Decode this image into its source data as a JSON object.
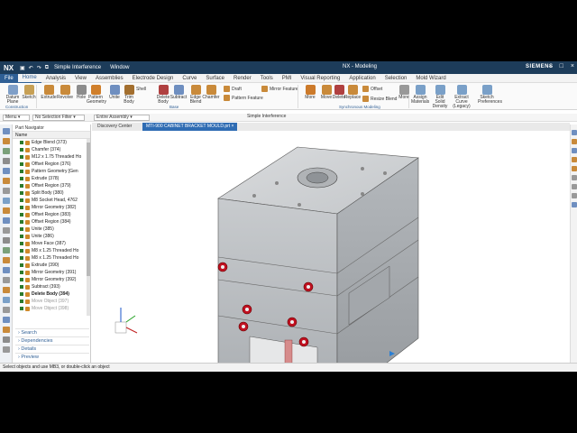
{
  "titlebar": {
    "logo": "NX",
    "command1": "Simple Interference",
    "command2": "Window",
    "center_title": "NX - Modeling",
    "brand": "SIEMENS"
  },
  "tabs": [
    "File",
    "Home",
    "Analysis",
    "View",
    "Assemblies",
    "Electrode Design",
    "Curve",
    "Surface",
    "Render",
    "Tools",
    "PMI",
    "Visual Reporting",
    "Application",
    "Selection",
    "Mold Wizard"
  ],
  "active_tab": "Home",
  "ribbon": {
    "buttons": [
      {
        "label": "Datum Plane",
        "color": "#7f9fc8"
      },
      {
        "label": "Sketch",
        "color": "#c7a055"
      },
      {
        "label": "Extrude",
        "color": "#c98a3a"
      },
      {
        "label": "Revolve",
        "color": "#c98a3a"
      },
      {
        "label": "Hole",
        "color": "#8c8c8c"
      },
      {
        "label": "Pattern Geometry",
        "color": "#d07f2b"
      },
      {
        "label": "Unite",
        "color": "#6f8fc0"
      },
      {
        "label": "Trim Body",
        "color": "#a36f2f"
      },
      {
        "label": "Delete Body",
        "color": "#b04040"
      },
      {
        "label": "Subtract",
        "color": "#6f8fc0"
      },
      {
        "label": "Edge Blend",
        "color": "#c98a3a"
      },
      {
        "label": "Chamfer",
        "color": "#c98a3a"
      },
      {
        "label": "More",
        "color": "#cc7a2a"
      },
      {
        "label": "Move",
        "color": "#c98a3a"
      },
      {
        "label": "Delete",
        "color": "#b04040"
      },
      {
        "label": "Replace",
        "color": "#c98a3a"
      },
      {
        "label": "More",
        "color": "#999999"
      },
      {
        "label": "Assign Materials",
        "color": "#7aa0c8"
      },
      {
        "label": "Edit Solid Density",
        "color": "#7aa0c8"
      },
      {
        "label": "Extract Curve (Legacy)",
        "color": "#7aa0c8"
      },
      {
        "label": "Sketch Preferences",
        "color": "#7aa0c8"
      }
    ],
    "small_buttons": {
      "shell": "Shell",
      "draft": "Draft",
      "pattern_feature": "Pattern Feature",
      "mirror_feature": "Mirror Feature",
      "offset": "Offset",
      "resize_blend": "Resize Blend"
    },
    "groups": {
      "construction": "Construction",
      "base": "Base",
      "synchronous": "Synchronous Modeling"
    }
  },
  "filterbar": {
    "menu": "Menu",
    "selection_filter": "No Selection Filter",
    "scope": "Entire Assembly",
    "interference": "Simple Interference"
  },
  "doctabs": [
    "Discovery Center",
    "MTI-900 CABINET BRACKET MOULD.prt"
  ],
  "navigator": {
    "title": "Part Navigator",
    "column": "Name",
    "items": [
      {
        "label": "Edge Blend (373)",
        "style": ""
      },
      {
        "label": "Chamfer (374)",
        "style": ""
      },
      {
        "label": "M12 x 1.75 Threaded Ho",
        "style": ""
      },
      {
        "label": "Offset Region (376)",
        "style": ""
      },
      {
        "label": "Pattern Geometry [Gen",
        "style": ""
      },
      {
        "label": "Extrude (378)",
        "style": ""
      },
      {
        "label": "Offset Region (379)",
        "style": ""
      },
      {
        "label": "Split Body (380)",
        "style": ""
      },
      {
        "label": "M8 Socket Head, 4762",
        "style": ""
      },
      {
        "label": "Mirror Geometry (382)",
        "style": ""
      },
      {
        "label": "Offset Region (383)",
        "style": ""
      },
      {
        "label": "Offset Region (384)",
        "style": ""
      },
      {
        "label": "Unite (385)",
        "style": ""
      },
      {
        "label": "Unite (386)",
        "style": ""
      },
      {
        "label": "Move Face (387)",
        "style": ""
      },
      {
        "label": "M8 x 1.25 Threaded Ho",
        "style": ""
      },
      {
        "label": "M8 x 1.25 Threaded Ho",
        "style": ""
      },
      {
        "label": "Extrude (390)",
        "style": ""
      },
      {
        "label": "Mirror Geometry (391)",
        "style": ""
      },
      {
        "label": "Mirror Geometry (392)",
        "style": ""
      },
      {
        "label": "Subtract (393)",
        "style": ""
      },
      {
        "label": "Delete Body (394)",
        "style": "bold"
      },
      {
        "label": "Move Object (397)",
        "style": "dim"
      },
      {
        "label": "Move Object (398)",
        "style": "dim"
      }
    ],
    "panels": [
      "Search",
      "Dependencies",
      "Details",
      "Preview"
    ]
  },
  "status_text": "Select objects and use MB3, or double-click an object",
  "colors": {
    "accent": "#2f5f95",
    "model_gray": "#b9bcbf",
    "bushing_red": "#c01020"
  }
}
